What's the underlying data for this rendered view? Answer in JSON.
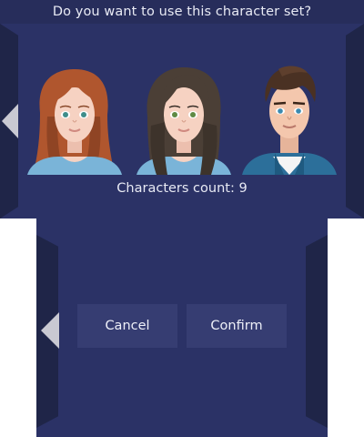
{
  "top": {
    "title": "Do you want to use this character set?",
    "count_label": "Characters count: 9"
  },
  "characters": [
    {
      "name": "red-haired-woman",
      "hair": "#b0562e",
      "skin": "#f6d2c2",
      "shirt": "#7ab4d8",
      "eyes": "#3f8d8a"
    },
    {
      "name": "brown-haired-woman",
      "hair": "#4b3f36",
      "skin": "#f6d2c2",
      "shirt": "#7ab4d8",
      "eyes": "#5f8a44"
    },
    {
      "name": "brown-haired-man",
      "hair": "#4a3123",
      "skin": "#f4c7ad",
      "shirt": "#2c6f9a",
      "eyes": "#3b8ab0"
    }
  ],
  "buttons": {
    "cancel": "Cancel",
    "confirm": "Confirm"
  },
  "colors": {
    "background": "#2b3266",
    "title_bar": "#272d5b",
    "side_panel": "#1f2548",
    "button": "#363d72",
    "arrow": "#c9c9d2"
  },
  "icons": {
    "nav_left_top": "left-arrow-icon",
    "nav_left_bottom": "left-arrow-icon"
  }
}
